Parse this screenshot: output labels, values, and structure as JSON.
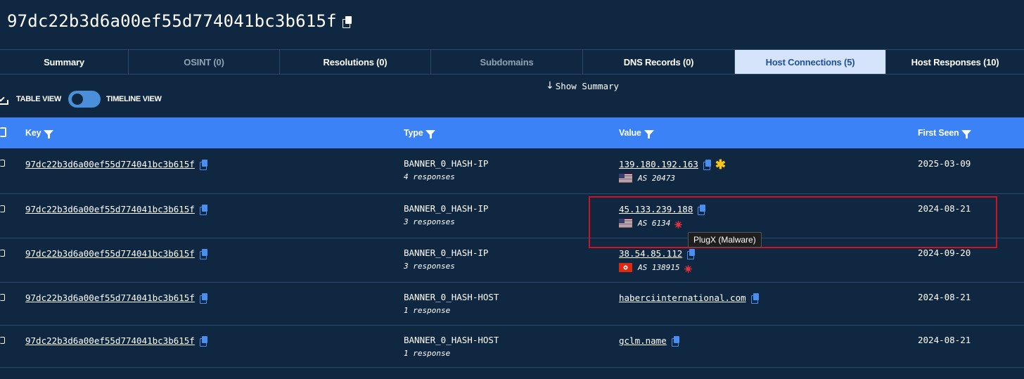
{
  "header": {
    "title": "97dc22b3d6a00ef55d774041bc3b615f"
  },
  "tabs": [
    {
      "label": "Summary"
    },
    {
      "label": "OSINT (0)"
    },
    {
      "label": "Resolutions (0)"
    },
    {
      "label": "Subdomains"
    },
    {
      "label": "DNS Records (0)"
    },
    {
      "label": "Host Connections (5)"
    },
    {
      "label": "Host Responses (10)"
    }
  ],
  "active_tab": "Host Connections (5)",
  "show_summary": "Show Summary",
  "view_toggle": {
    "table_label": "TABLE VIEW",
    "timeline_label": "TIMELINE VIEW"
  },
  "table": {
    "columns": {
      "key": "Key",
      "type": "Type",
      "value": "Value",
      "first_seen": "First Seen"
    },
    "rows": [
      {
        "key": "97dc22b3d6a00ef55d774041bc3b615f",
        "type": "BANNER_0_HASH-IP",
        "responses": "4 responses",
        "value": "139.180.192.163",
        "as": "AS 20473",
        "flag": "US",
        "first_seen": "2025-03-09"
      },
      {
        "key": "97dc22b3d6a00ef55d774041bc3b615f",
        "type": "BANNER_0_HASH-IP",
        "responses": "3 responses",
        "value": "45.133.239.188",
        "as": "AS 6134",
        "flag": "US",
        "first_seen": "2024-08-21"
      },
      {
        "key": "97dc22b3d6a00ef55d774041bc3b615f",
        "type": "BANNER_0_HASH-IP",
        "responses": "3 responses",
        "value": "38.54.85.112",
        "as": "AS 138915",
        "flag": "HK",
        "first_seen": "2024-09-20"
      },
      {
        "key": "97dc22b3d6a00ef55d774041bc3b615f",
        "type": "BANNER_0_HASH-HOST",
        "responses": "1 response",
        "value": "haberciinternational.com",
        "first_seen": "2024-08-21"
      },
      {
        "key": "97dc22b3d6a00ef55d774041bc3b615f",
        "type": "BANNER_0_HASH-HOST",
        "responses": "1 response",
        "value": "gclm.name",
        "first_seen": "2024-08-21"
      }
    ]
  },
  "tooltip": "PlugX (Malware)",
  "colors": {
    "background": "#0f2740",
    "table_header": "#3b82f6",
    "active_tab_bg": "#d5e3fb",
    "active_tab_text": "#1d4f9e",
    "copy_icon": "#4a8ef0",
    "malware_icon": "#e0323c",
    "star_icon": "#f5c518",
    "highlight_box": "#d0131f"
  }
}
